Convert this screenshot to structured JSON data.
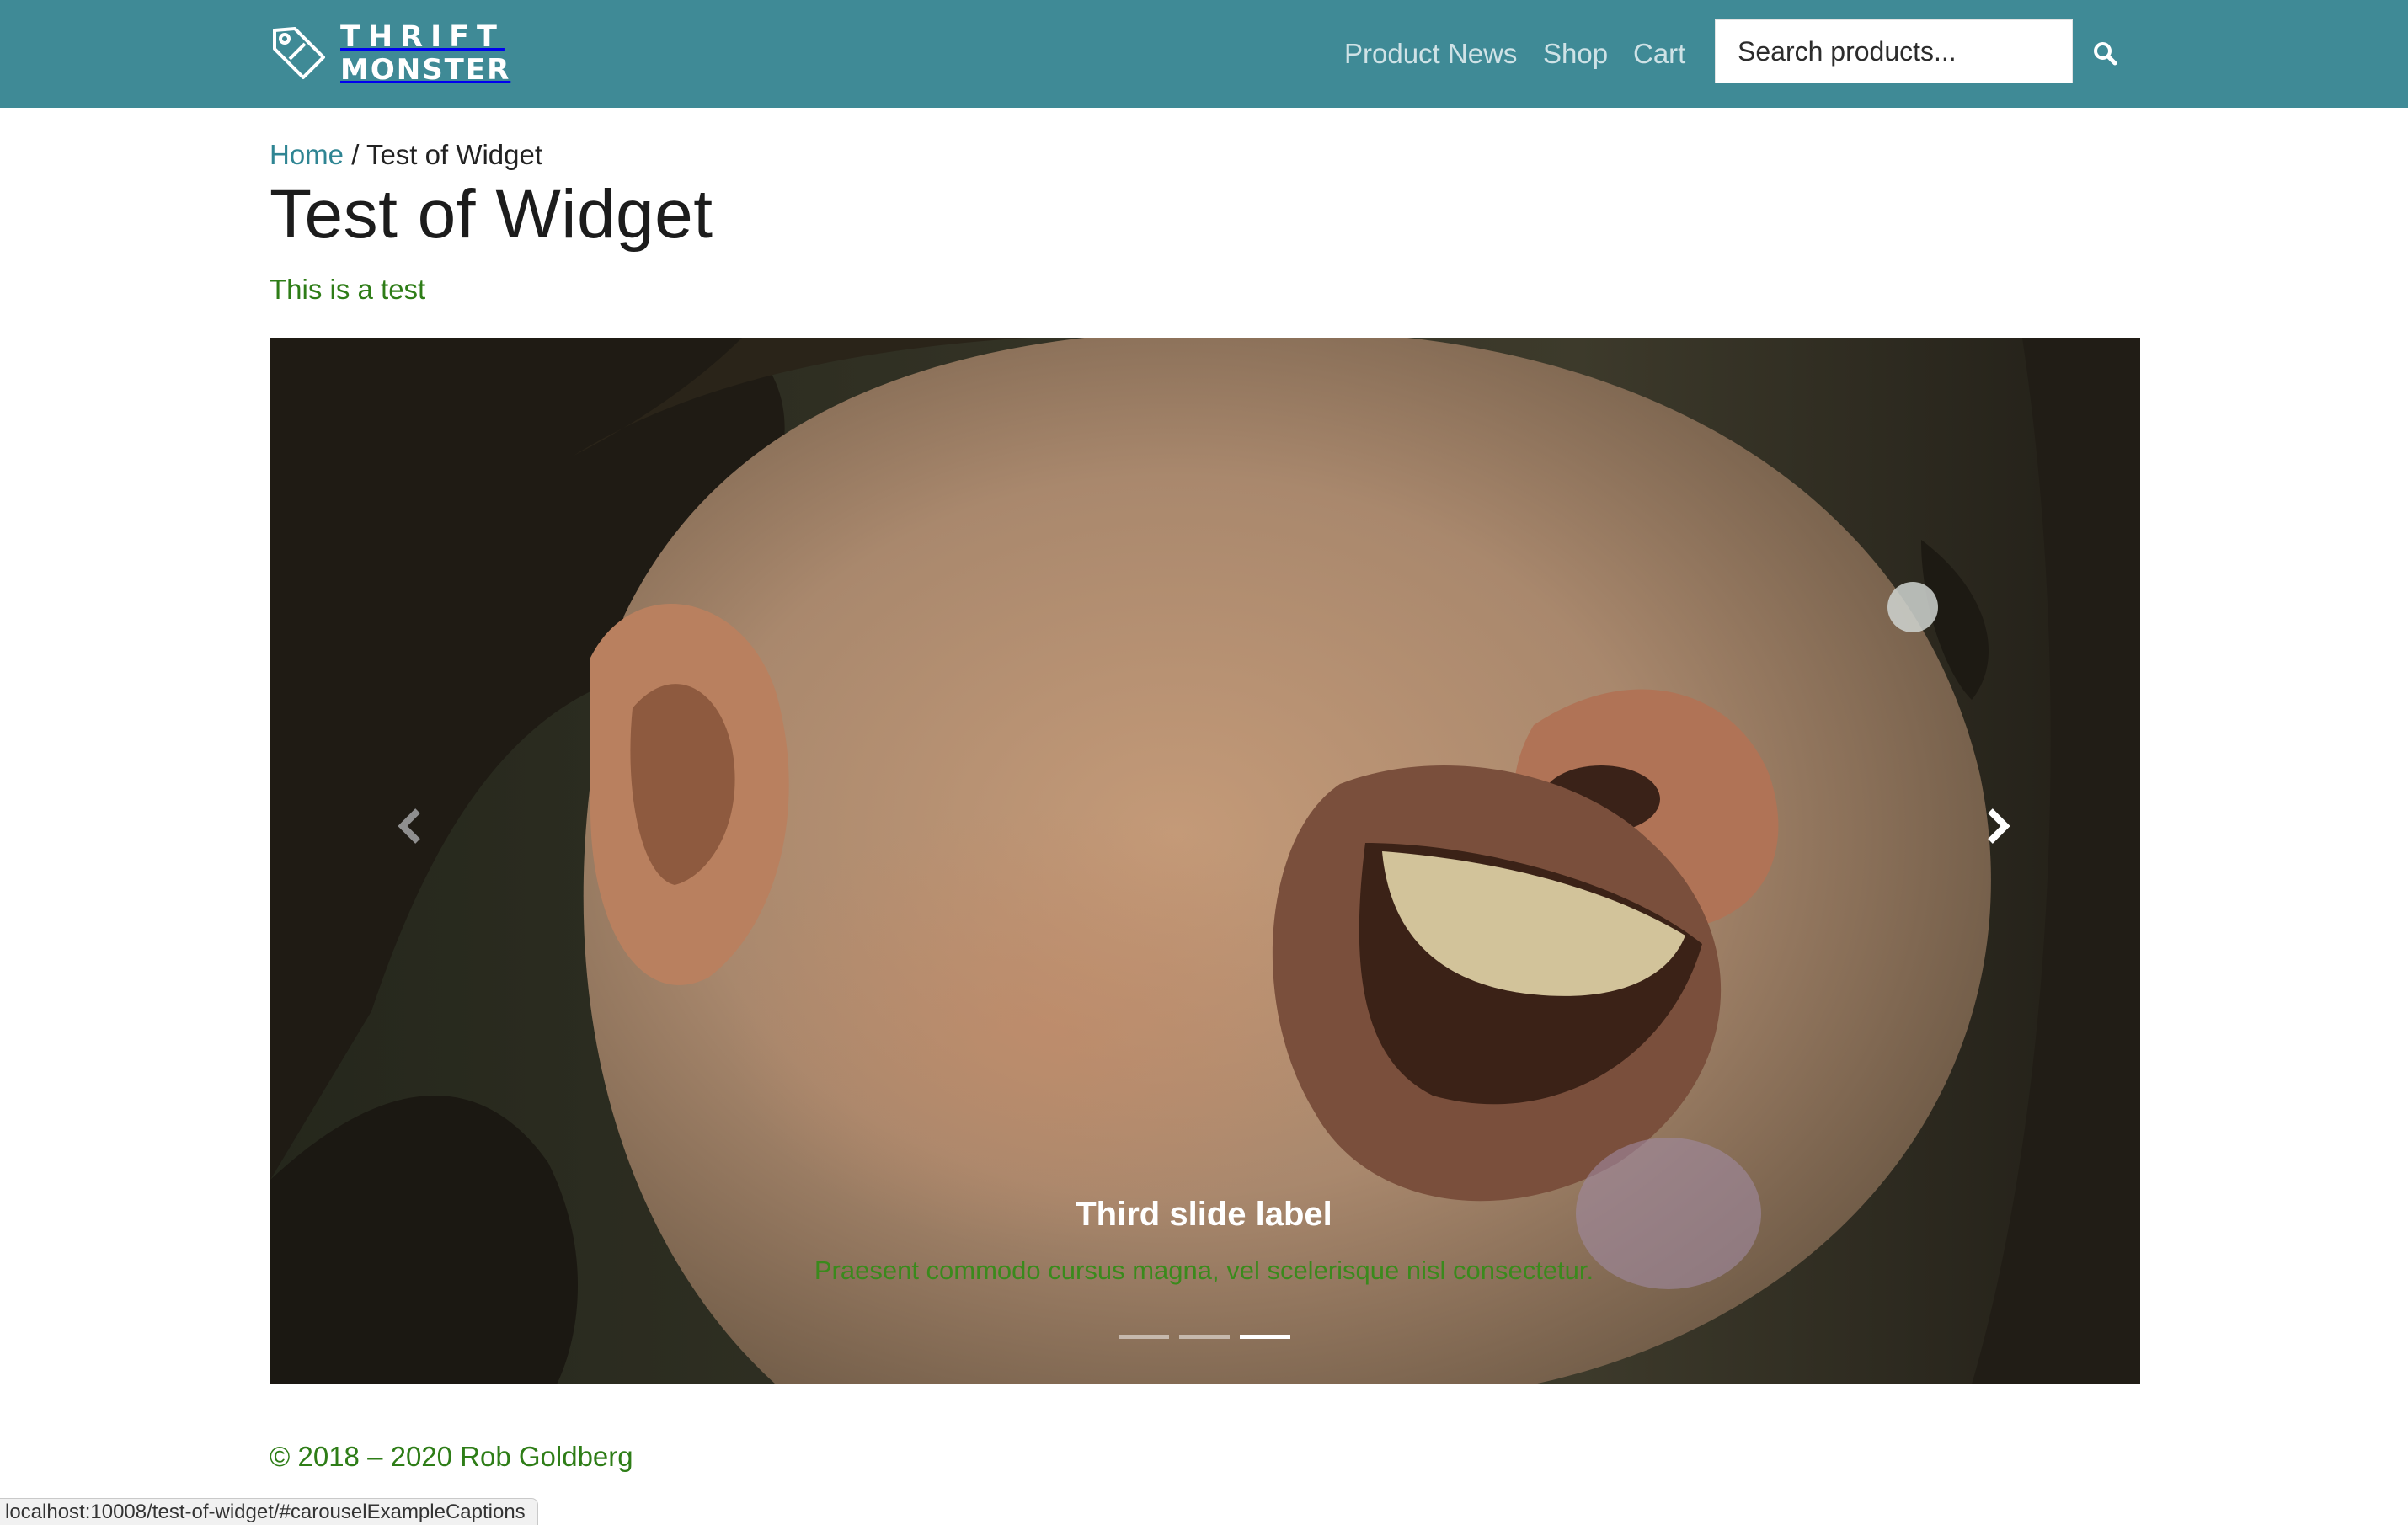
{
  "brand": {
    "line1": "THRIFT",
    "line2": "MONSTER",
    "icon": "price-tag-icon"
  },
  "nav": {
    "items": [
      {
        "label": "Product News"
      },
      {
        "label": "Shop"
      },
      {
        "label": "Cart"
      }
    ]
  },
  "search": {
    "placeholder": "Search products...",
    "icon": "search-icon"
  },
  "breadcrumb": {
    "home": "Home",
    "separator": " / ",
    "current": "Test of Widget"
  },
  "page": {
    "title": "Test of Widget",
    "subtitle": "This is a test"
  },
  "carousel": {
    "slide_title": "Third slide label",
    "slide_text": "Praesent commodo cursus magna, vel scelerisque nisl consectetur.",
    "prev_icon": "chevron-left-icon",
    "next_icon": "chevron-right-icon",
    "slide_count": 3,
    "active_index": 2
  },
  "footer": {
    "text": "© 2018 – 2020 Rob Goldberg"
  },
  "status": {
    "url": "localhost:10008/test-of-widget/#carouselExampleCaptions"
  },
  "colors": {
    "header": "#3f8a96",
    "link": "#2f8593",
    "accent_green": "#2e7d17"
  }
}
